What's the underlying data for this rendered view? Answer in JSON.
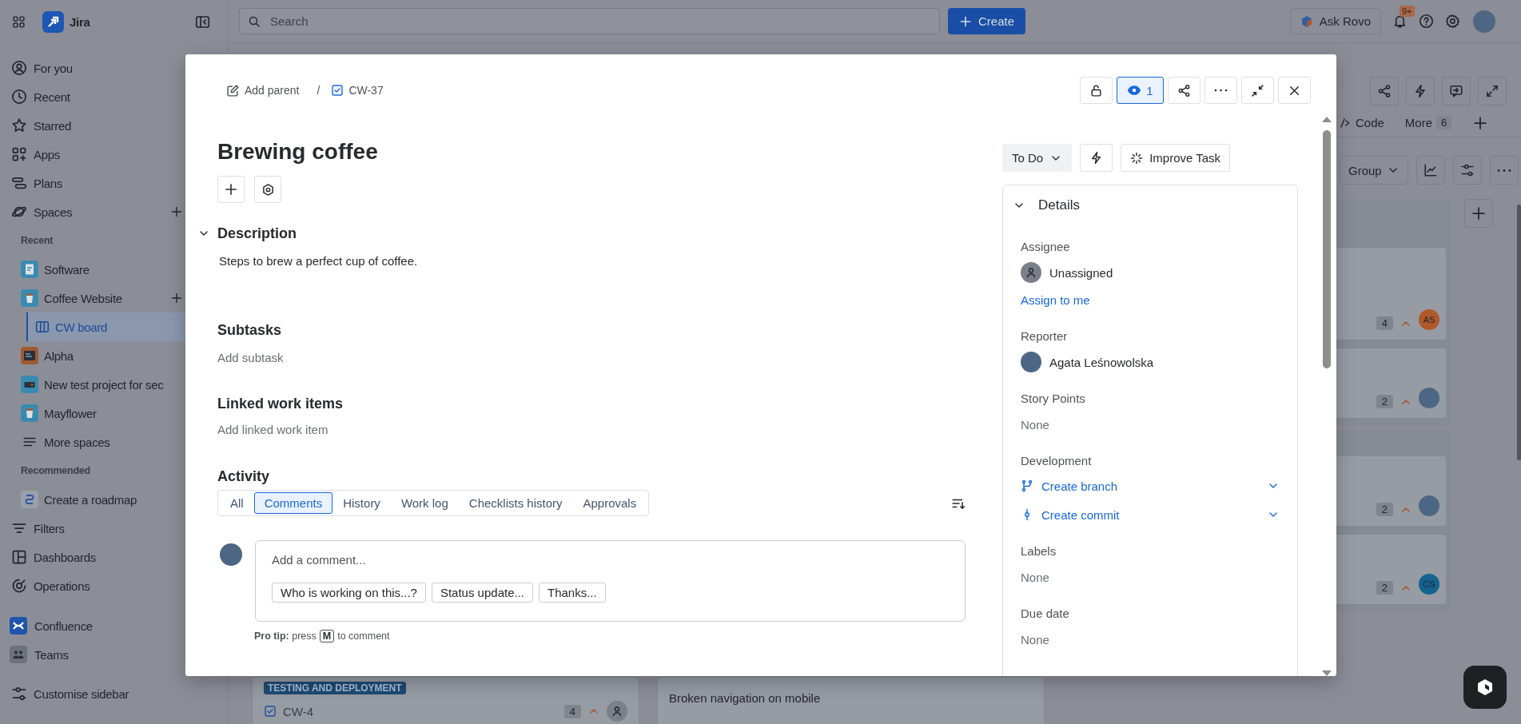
{
  "sidebar": {
    "product": "Jira",
    "items": [
      {
        "kind": "nav",
        "label": "For you",
        "selected": false
      },
      {
        "kind": "nav",
        "label": "Recent",
        "selected": false
      },
      {
        "kind": "nav",
        "label": "Starred",
        "selected": false
      },
      {
        "kind": "nav",
        "label": "Apps",
        "selected": false
      },
      {
        "kind": "nav",
        "label": "Plans",
        "selected": false
      },
      {
        "kind": "nav",
        "label": "Spaces",
        "selected": false,
        "add": true
      },
      {
        "kind": "heading",
        "label": "Recent"
      },
      {
        "kind": "space",
        "label": "Software",
        "selected": false
      },
      {
        "kind": "space",
        "label": "Coffee Website",
        "selected": false,
        "add": true
      },
      {
        "kind": "board",
        "label": "CW board",
        "selected": true
      },
      {
        "kind": "space",
        "label": "Alpha",
        "selected": false
      },
      {
        "kind": "space",
        "label": "New test project for sec",
        "selected": false
      },
      {
        "kind": "space",
        "label": "Mayflower",
        "selected": false
      },
      {
        "kind": "space",
        "label": "More spaces",
        "selected": false
      },
      {
        "kind": "heading",
        "label": "Recommended"
      },
      {
        "kind": "space",
        "label": "Create a roadmap",
        "selected": false
      },
      {
        "kind": "nav",
        "label": "Filters",
        "selected": false
      },
      {
        "kind": "nav",
        "label": "Dashboards",
        "selected": false
      },
      {
        "kind": "nav",
        "label": "Operations",
        "selected": false
      },
      {
        "kind": "app",
        "label": "Confluence",
        "selected": false
      },
      {
        "kind": "app",
        "label": "Teams",
        "selected": false
      },
      {
        "kind": "footer",
        "label": "Customise sidebar",
        "selected": false
      }
    ]
  },
  "topbar": {
    "search": {
      "placeholder": "Search"
    },
    "create": "Create",
    "assistant": "Ask Rovo",
    "notifications": "9+"
  },
  "board": {
    "tabs": [
      {
        "label": "Code",
        "selected": false
      },
      {
        "label": "More",
        "count": "6",
        "selected": false
      }
    ],
    "group_by": "Group",
    "groups": [
      {
        "cards": [
          {
            "estimate": "4",
            "avatar": {
              "kind": "initials",
              "initials": "AS",
              "color": "#b0592a"
            }
          },
          {
            "estimate": "2",
            "avatar": {
              "kind": "photo"
            }
          }
        ]
      },
      {
        "cards": [
          {
            "estimate": "2",
            "avatar": {
              "kind": "photo"
            }
          },
          {
            "estimate": "2",
            "avatar": {
              "kind": "initials",
              "initials": "CS",
              "color": "#14638f"
            }
          }
        ]
      }
    ],
    "bottom_cards": [
      {
        "kind": "item",
        "tag": "TESTING AND DEPLOYMENT",
        "key": "CW-4",
        "estimate": "4"
      },
      {
        "kind": "title",
        "title": "Broken navigation on mobile"
      }
    ]
  },
  "issue": {
    "breadcrumb": {
      "parent": "Add parent",
      "separator": "/",
      "key": "CW-37"
    },
    "watchers": {
      "count": "1",
      "watching": true
    },
    "title": "Brewing coffee",
    "description": {
      "heading": "Description",
      "expanded": true,
      "text": "Steps to brew a perfect cup of coffee."
    },
    "subtasks": {
      "heading": "Subtasks",
      "action": "Add subtask"
    },
    "linked_items": {
      "heading": "Linked work items",
      "action": "Add linked work item"
    },
    "activity": {
      "heading": "Activity",
      "tabs": [
        {
          "label": "All",
          "selected": false
        },
        {
          "label": "Comments",
          "selected": true
        },
        {
          "label": "History",
          "selected": false
        },
        {
          "label": "Work log",
          "selected": false
        },
        {
          "label": "Checklists history",
          "selected": false
        },
        {
          "label": "Approvals",
          "selected": false
        }
      ],
      "comment": {
        "placeholder": "Add a comment...",
        "suggestions": [
          "Who is working on this...?",
          "Status update...",
          "Thanks..."
        ]
      },
      "pro_tip": {
        "text": "**Pro tip:** press",
        "key": "M",
        "after": "to comment"
      }
    },
    "status": "To Do",
    "improve": "Improve Task",
    "details": {
      "heading": "Details",
      "expanded": true,
      "fields": [
        {
          "kind": "person",
          "label": "Assignee",
          "photo": false,
          "value": "Unassigned",
          "action": "Assign to me"
        },
        {
          "kind": "person",
          "label": "Reporter",
          "photo": true,
          "value": "Agata Leśnowolska"
        },
        {
          "kind": "text",
          "label": "Story Points",
          "value": "None"
        },
        {
          "kind": "links",
          "label": "Development",
          "links": [
            "Create branch",
            "Create commit"
          ]
        },
        {
          "kind": "text",
          "label": "Labels",
          "value": "None"
        },
        {
          "kind": "text",
          "label": "Due date",
          "value": "None"
        }
      ]
    }
  }
}
